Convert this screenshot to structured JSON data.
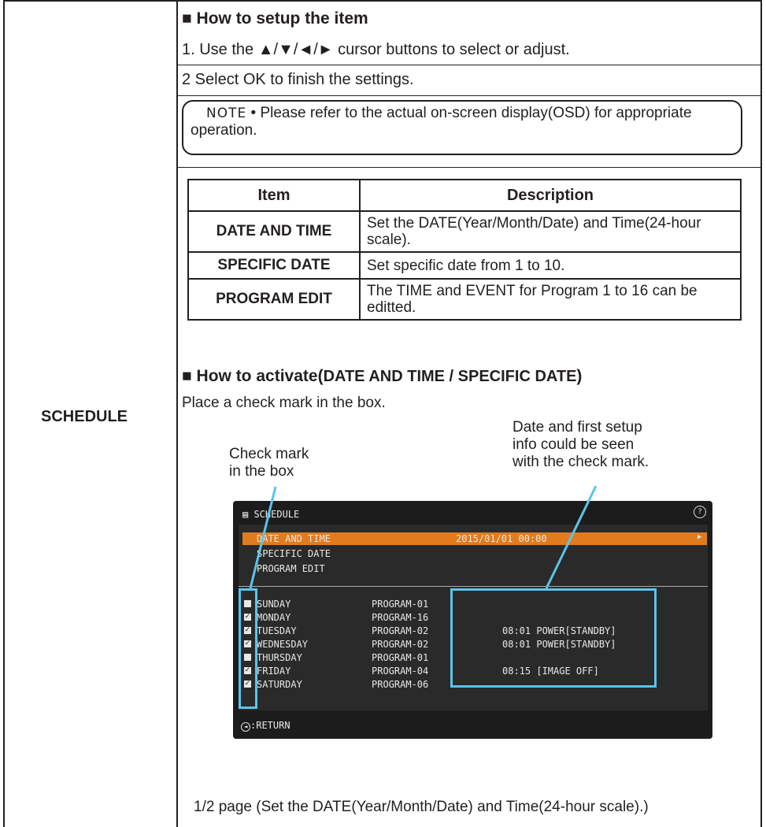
{
  "left_label": "SCHEDULE",
  "setup": {
    "heading": "How to setup the item",
    "line1": "1. Use the ▲/▼/◄/► cursor buttons to select or adjust.",
    "line2": "2 Select OK to finish the settings."
  },
  "note": {
    "tag": "NOTE",
    "text": " • Please refer to the actual on-screen display(OSD) for appropriate operation."
  },
  "table": {
    "headers": [
      "Item",
      "Description"
    ],
    "rows": [
      {
        "item": "DATE AND TIME",
        "desc": "Set the DATE(Year/Month/Date) and Time(24-hour scale)."
      },
      {
        "item": "SPECIFIC DATE",
        "desc": "Set specific date from 1 to 10."
      },
      {
        "item": "PROGRAM EDIT",
        "desc": "The TIME and EVENT for Program 1 to 16 can be editted."
      }
    ]
  },
  "activate": {
    "heading": "How to activate(",
    "heading_sub": "DATE AND TIME / SPECIFIC DATE",
    "heading_end": ")",
    "instruction": "Place a check mark in the box."
  },
  "callouts": {
    "check_mark": [
      "Check mark",
      "in the box"
    ],
    "date_info": [
      "Date and first setup",
      "info could be seen",
      "with the check mark."
    ]
  },
  "osd": {
    "title": "SCHEDULE",
    "menu": [
      {
        "label": "DATE AND TIME",
        "value": "2015/01/01 00:00",
        "selected": true
      },
      {
        "label": "SPECIFIC DATE",
        "value": "",
        "selected": false
      },
      {
        "label": "PROGRAM EDIT",
        "value": "",
        "selected": false
      }
    ],
    "days": [
      {
        "day": "SUNDAY",
        "checked": false,
        "program": "PROGRAM-01",
        "info": ""
      },
      {
        "day": "MONDAY",
        "checked": true,
        "program": "PROGRAM-16",
        "info": ""
      },
      {
        "day": "TUESDAY",
        "checked": true,
        "program": "PROGRAM-02",
        "info": "08:01 POWER[STANDBY]"
      },
      {
        "day": "WEDNESDAY",
        "checked": true,
        "program": "PROGRAM-02",
        "info": "08:01 POWER[STANDBY]"
      },
      {
        "day": "THURSDAY",
        "checked": false,
        "program": "PROGRAM-01",
        "info": ""
      },
      {
        "day": "FRIDAY",
        "checked": true,
        "program": "PROGRAM-04",
        "info": "08:15 [IMAGE OFF]"
      },
      {
        "day": "SATURDAY",
        "checked": true,
        "program": "PROGRAM-06",
        "info": ""
      }
    ],
    "footer": ":RETURN",
    "highlight_color": "#5bc4ea",
    "selected_color": "#e07c1f"
  },
  "caption": "1/2 page (Set the DATE(Year/Month/Date) and Time(24-hour scale).)"
}
